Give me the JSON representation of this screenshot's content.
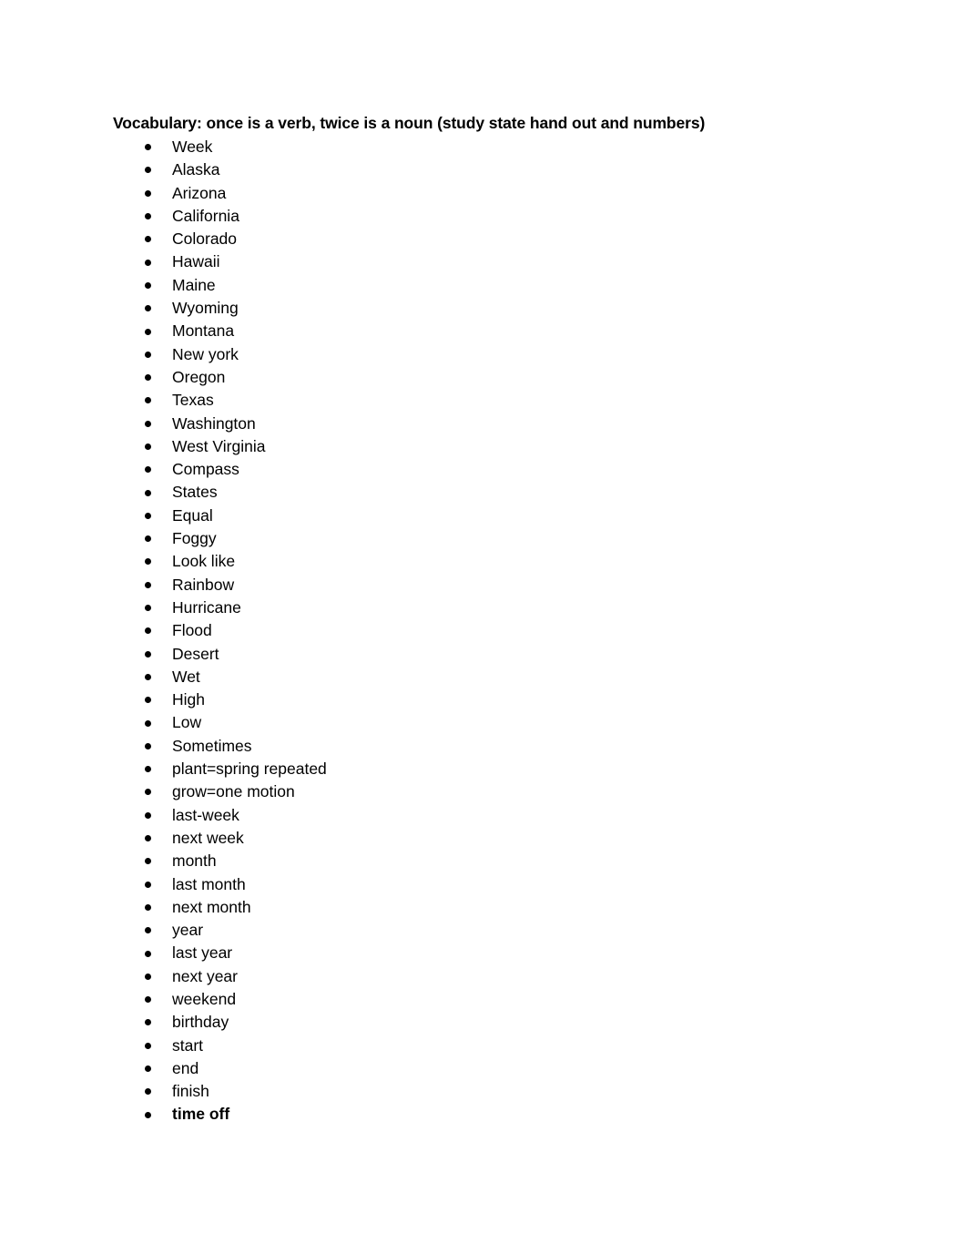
{
  "document": {
    "title": "Vocabulary: once is a verb, twice is a noun (study state hand out and numbers)",
    "bullet_glyph": "bullet-dot",
    "text_color": "#000000",
    "background_color": "#ffffff",
    "items": [
      {
        "label": "Week",
        "bold": false
      },
      {
        "label": "Alaska",
        "bold": false
      },
      {
        "label": "Arizona",
        "bold": false
      },
      {
        "label": "California",
        "bold": false
      },
      {
        "label": "Colorado",
        "bold": false
      },
      {
        "label": "Hawaii",
        "bold": false
      },
      {
        "label": "Maine",
        "bold": false
      },
      {
        "label": "Wyoming",
        "bold": false
      },
      {
        "label": "Montana",
        "bold": false
      },
      {
        "label": "New york",
        "bold": false
      },
      {
        "label": "Oregon",
        "bold": false
      },
      {
        "label": "Texas",
        "bold": false
      },
      {
        "label": "Washington",
        "bold": false
      },
      {
        "label": "West Virginia",
        "bold": false
      },
      {
        "label": "Compass",
        "bold": false
      },
      {
        "label": "States",
        "bold": false
      },
      {
        "label": "Equal",
        "bold": false
      },
      {
        "label": "Foggy",
        "bold": false
      },
      {
        "label": "Look like",
        "bold": false
      },
      {
        "label": "Rainbow",
        "bold": false
      },
      {
        "label": "Hurricane",
        "bold": false
      },
      {
        "label": "Flood",
        "bold": false
      },
      {
        "label": "Desert",
        "bold": false
      },
      {
        "label": "Wet",
        "bold": false
      },
      {
        "label": "High",
        "bold": false
      },
      {
        "label": "Low",
        "bold": false
      },
      {
        "label": "Sometimes",
        "bold": false
      },
      {
        "label": "plant=spring repeated",
        "bold": false
      },
      {
        "label": "grow=one motion",
        "bold": false
      },
      {
        "label": "last-week",
        "bold": false
      },
      {
        "label": "next week",
        "bold": false
      },
      {
        "label": "month",
        "bold": false
      },
      {
        "label": "last month",
        "bold": false
      },
      {
        "label": "next month",
        "bold": false
      },
      {
        "label": "year",
        "bold": false
      },
      {
        "label": "last year",
        "bold": false
      },
      {
        "label": "next year",
        "bold": false
      },
      {
        "label": "weekend",
        "bold": false
      },
      {
        "label": "birthday",
        "bold": false
      },
      {
        "label": "start",
        "bold": false
      },
      {
        "label": "end",
        "bold": false
      },
      {
        "label": "finish",
        "bold": false
      },
      {
        "label": "time off",
        "bold": true
      }
    ]
  }
}
